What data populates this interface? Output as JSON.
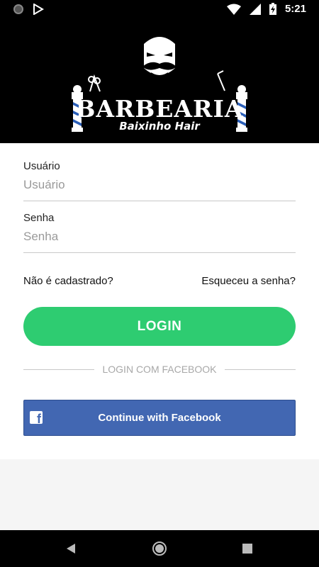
{
  "status_bar": {
    "time": "5:21",
    "icons": [
      "record-icon",
      "play-store-icon",
      "wifi-icon",
      "cellular-signal-icon",
      "battery-charging-icon"
    ]
  },
  "header": {
    "brand_title": "BARBEARIA",
    "brand_subtitle": "Baixinho Hair"
  },
  "form": {
    "username": {
      "label": "Usuário",
      "placeholder": "Usuário",
      "value": ""
    },
    "password": {
      "label": "Senha",
      "placeholder": "Senha",
      "value": ""
    }
  },
  "links": {
    "register": "Não é cadastrado?",
    "forgot_password": "Esqueceu a senha?"
  },
  "login_button": "LOGIN",
  "divider_text": "LOGIN COM FACEBOOK",
  "facebook_button": {
    "label": "Continue with Facebook",
    "icon": "facebook-icon"
  },
  "nav_bar": {
    "icons": [
      "back-icon",
      "home-icon",
      "recents-icon"
    ]
  },
  "colors": {
    "primary_green": "#2ecc71",
    "facebook_blue": "#4267b2",
    "header_bg": "#000000"
  }
}
